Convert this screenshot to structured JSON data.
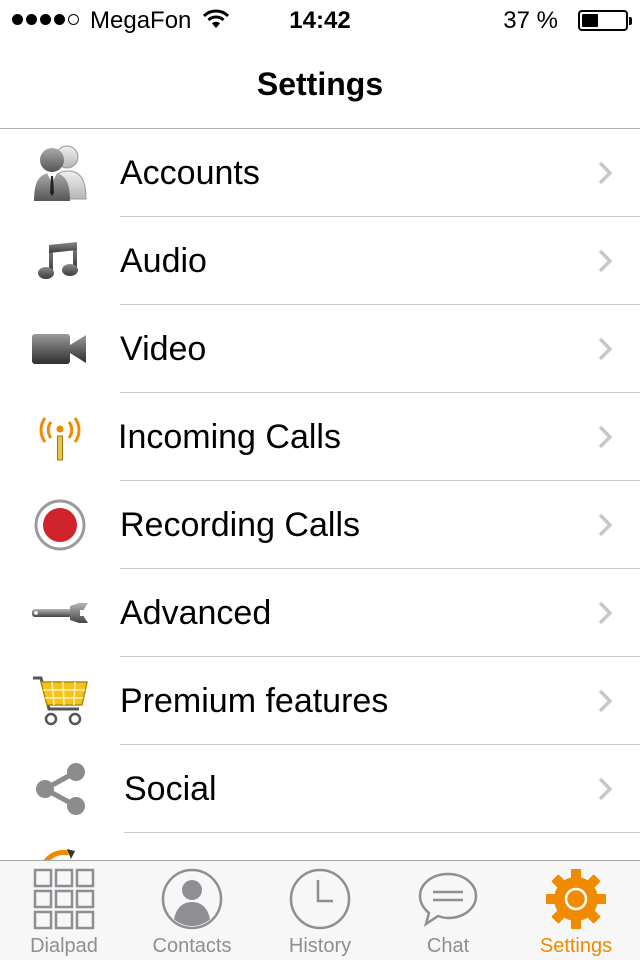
{
  "status_bar": {
    "carrier": "MegaFon",
    "time": "14:42",
    "battery_percent": "37 %",
    "signal_bars": 4,
    "signal_total": 5,
    "battery_level": 0.37
  },
  "nav": {
    "title": "Settings"
  },
  "settings": {
    "items": [
      {
        "label": "Accounts",
        "icon": "accounts-icon"
      },
      {
        "label": "Audio",
        "icon": "music-note-icon"
      },
      {
        "label": "Video",
        "icon": "video-camera-icon"
      },
      {
        "label": "Incoming Calls",
        "icon": "antenna-icon"
      },
      {
        "label": "Recording Calls",
        "icon": "record-icon"
      },
      {
        "label": "Advanced",
        "icon": "wrench-icon"
      },
      {
        "label": "Premium features",
        "icon": "cart-icon"
      },
      {
        "label": "Social",
        "icon": "share-icon"
      }
    ]
  },
  "tabbar": {
    "tabs": [
      {
        "label": "Dialpad",
        "icon": "dialpad-icon",
        "active": false
      },
      {
        "label": "Contacts",
        "icon": "contacts-icon",
        "active": false
      },
      {
        "label": "History",
        "icon": "history-clock-icon",
        "active": false
      },
      {
        "label": "Chat",
        "icon": "chat-bubble-icon",
        "active": false
      },
      {
        "label": "Settings",
        "icon": "settings-gear-icon",
        "active": true
      }
    ]
  },
  "colors": {
    "accent": "#f08a00",
    "inactive_tab": "#8e8e93",
    "separator": "#c8c7cc",
    "record_red": "#d0232b"
  }
}
